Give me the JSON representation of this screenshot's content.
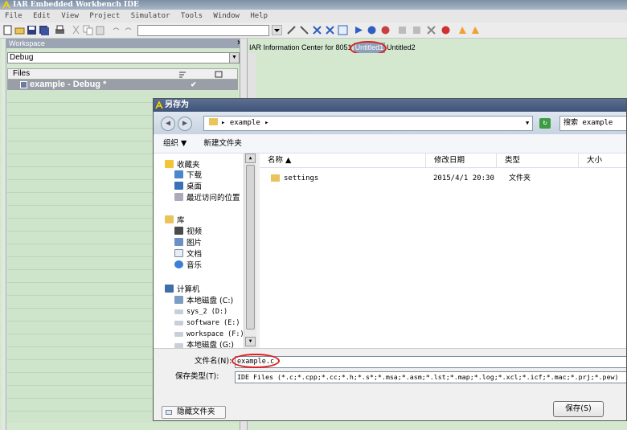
{
  "app": {
    "title": "IAR Embedded Workbench IDE",
    "menu": [
      "File",
      "Edit",
      "View",
      "Project",
      "Simulator",
      "Tools",
      "Window",
      "Help"
    ]
  },
  "workspace": {
    "header": "Workspace",
    "close": "×",
    "config": "Debug",
    "files_col": "Files",
    "project": "example - Debug *",
    "check": "✔"
  },
  "tabs": [
    "IAR Information Center for 8051",
    "Untitled1",
    "Untitled2"
  ],
  "dialog": {
    "title": "另存为",
    "back": "◀",
    "forward": "▶",
    "path": "▸ example ▸",
    "dropdown": "▼",
    "refresh": "↻",
    "search_placeholder": "搜索 example",
    "cmd_organize": "组织 ▼",
    "cmd_new_folder": "新建文件夹",
    "nav": {
      "favorites": "收藏夹",
      "downloads": "下载",
      "desktop": "桌面",
      "recent": "最近访问的位置",
      "library": "库",
      "videos": "视频",
      "pictures": "图片",
      "documents": "文档",
      "music": "音乐",
      "computer": "计算机",
      "drive_c": "本地磁盘 (C:)",
      "drive_d": "sys_2 (D:)",
      "drive_e": "software (E:)",
      "drive_f": "workspace (F:)",
      "drive_g": "本地磁盘 (G:)"
    },
    "columns": {
      "name": "名称 ▲",
      "date": "修改日期",
      "type": "类型",
      "size": "大小"
    },
    "rows": [
      {
        "name": "settings",
        "date": "2015/4/1 20:30",
        "type": "文件夹"
      }
    ],
    "filename_label": "文件名(N):",
    "filename_value": "example.c",
    "filetype_label": "保存类型(T):",
    "filetype_value": "IDE Files (*.c;*.cpp;*.cc;*.h;*.s*;*.msa;*.asm;*.lst;*.map;*.log;*.xcl;*.icf;*.mac;*.prj;*.pew)",
    "hide_folders": "隐藏文件夹",
    "save": "保存(S)"
  },
  "colors": {
    "background": "#d4e8d0",
    "title_bar": "#7d8fa6",
    "dialog_title": "#4a5e84",
    "highlight_ring": "#e02020",
    "folder": "#e9c45c"
  }
}
